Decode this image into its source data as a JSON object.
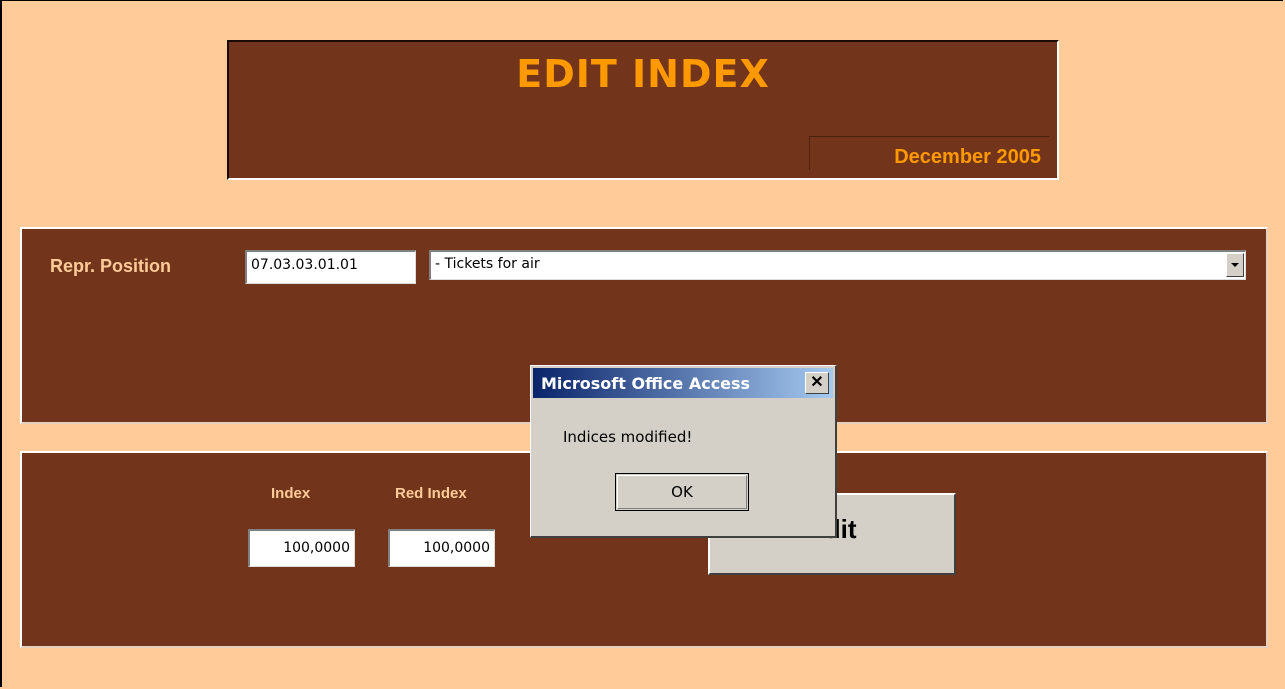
{
  "header": {
    "title": "EDIT INDEX",
    "date": "December 2005"
  },
  "position": {
    "label": "Repr. Position",
    "code_value": "07.03.03.01.01",
    "description_value": "- Tickets for air"
  },
  "indices": {
    "index_label": "Index",
    "index_value": "100,0000",
    "red_index_label": "Red Index",
    "red_index_value": "100,0000",
    "edit_button_label": "Edit"
  },
  "dialog": {
    "title": "Microsoft Office Access",
    "close_label": "✕",
    "message": "Indices modified!",
    "ok_label": "OK"
  },
  "colors": {
    "background": "#ffcc99",
    "panel": "#72341a",
    "title_text": "#ff9900",
    "label_text": "#ffcc99"
  }
}
